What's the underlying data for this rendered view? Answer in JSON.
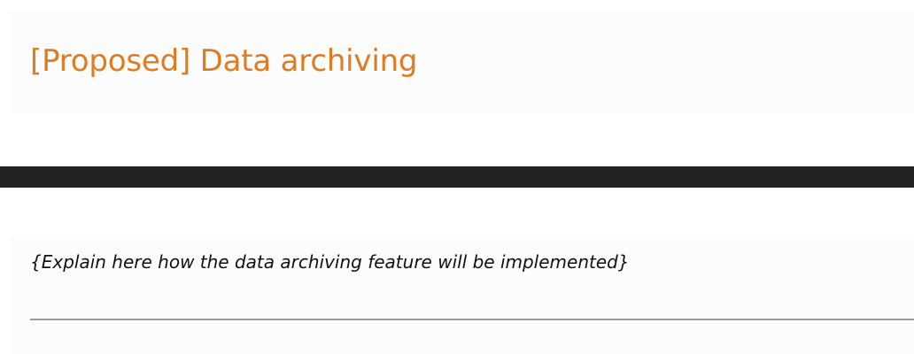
{
  "document": {
    "title": "[Proposed] Data archiving",
    "placeholder": "{Explain here how the data archiving feature will be implemented}"
  },
  "colors": {
    "title": "#e07b22",
    "dark_bar": "#232323",
    "rule": "#9a9a9a",
    "band_background": "#fcfcfc"
  }
}
